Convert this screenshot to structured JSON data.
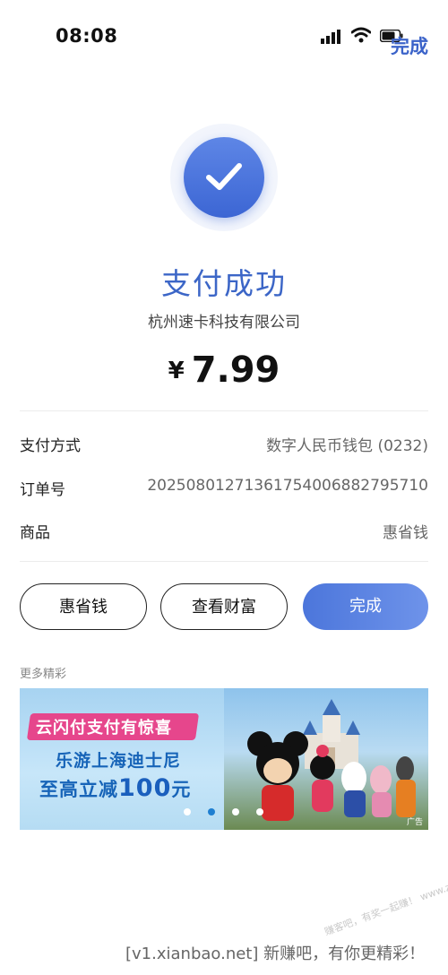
{
  "status_bar": {
    "time": "08:08"
  },
  "header": {
    "done_label": "完成"
  },
  "result": {
    "title": "支付成功",
    "merchant": "杭州速卡科技有限公司",
    "currency_symbol": "¥",
    "amount": "7.99"
  },
  "details": [
    {
      "label": "支付方式",
      "value": "数字人民币钱包 (0232)"
    },
    {
      "label": "订单号",
      "value": "20250801271361754006882795710"
    },
    {
      "label": "商品",
      "value": "惠省钱"
    }
  ],
  "actions": {
    "huisheng_label": "惠省钱",
    "wealth_label": "查看财富",
    "done_label": "完成"
  },
  "more": {
    "title": "更多精彩",
    "banner": {
      "line1": "云闪付支付有惊喜",
      "line2": "乐游上海迪士尼",
      "line3_prefix": "至高立减",
      "line3_amount": "100",
      "line3_suffix": "元",
      "ad_tag": "广告"
    }
  },
  "watermark": {
    "diagonal": "赚客吧，有奖一起赚！ www.zuanke8.com",
    "footer": "[v1.xianbao.net] 新赚吧，有你更精彩！"
  },
  "colors": {
    "accent": "#3c66d4",
    "title_blue": "#3c66c7",
    "ribbon_pink": "#e6468c",
    "banner_blue": "#1764b8"
  },
  "icons": [
    "signal-icon",
    "wifi-icon",
    "battery-icon",
    "check-icon"
  ]
}
